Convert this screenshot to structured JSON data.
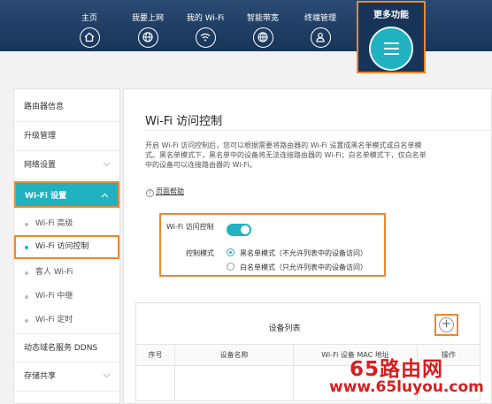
{
  "topnav": {
    "items": [
      {
        "label": "主页",
        "icon": "home-icon"
      },
      {
        "label": "我要上网",
        "icon": "globe-icon"
      },
      {
        "label": "我的 Wi-Fi",
        "icon": "wifi-icon"
      },
      {
        "label": "智能带宽",
        "icon": "bandwidth-globe-icon"
      },
      {
        "label": "终端管理",
        "icon": "user-icon"
      }
    ],
    "more": {
      "label": "更多功能",
      "icon": "menu-icon"
    }
  },
  "sidebar": {
    "items": [
      {
        "label": "路由器信息"
      },
      {
        "label": "升级管理"
      },
      {
        "label": "网络设置"
      }
    ],
    "active_group": {
      "label": "Wi-Fi 设置"
    },
    "sub_items": [
      {
        "label": "Wi-Fi 高级"
      },
      {
        "label": "Wi-Fi 访问控制"
      },
      {
        "label": "客人 Wi-Fi"
      },
      {
        "label": "Wi-Fi 中继"
      },
      {
        "label": "Wi-Fi 定时"
      }
    ],
    "bottom_items": [
      {
        "label": "动态域名服务 DDNS"
      },
      {
        "label": "存储共享"
      }
    ]
  },
  "main": {
    "title": "Wi-Fi 访问控制",
    "desc_line1": "开启 Wi-Fi 访问控制后，您可以根据需要将路由器的 Wi-Fi 设置成黑名单模式或白名单模",
    "desc_line2": "式。黑名单模式下，黑名单中的设备将无法连接路由器的 Wi-Fi；白名单模式下，仅白名单",
    "desc_line3": "中的设备可以连接路由器的 Wi-Fi。",
    "help_link": "页面帮助",
    "wifi_access_label": "Wi-Fi 访问控制",
    "wifi_access_enabled": true,
    "mode_label": "控制模式",
    "mode_options": [
      {
        "label": "黑名单模式（不允许列表中的设备访问）",
        "selected": true
      },
      {
        "label": "白名单模式（只允许列表中的设备访问）",
        "selected": false
      }
    ],
    "device_list": {
      "title": "设备列表",
      "add_symbol": "+",
      "columns": [
        "序号",
        "设备名称",
        "Wi-Fi 设备 MAC 地址",
        "操作"
      ]
    }
  },
  "watermark": {
    "line1": "65路由网",
    "line2": "www.65luyou.com"
  },
  "colors": {
    "accent": "#21b2c1",
    "highlight": "#f0872b",
    "header": "#1f3d64",
    "watermark": "#d81e1e"
  }
}
